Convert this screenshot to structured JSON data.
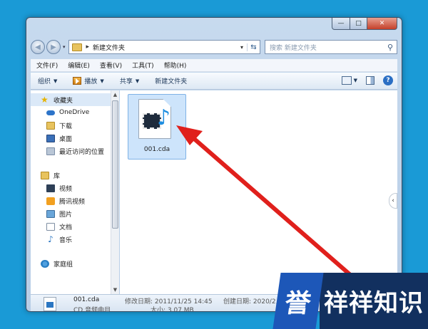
{
  "window": {
    "controls": {
      "minimize": "—",
      "maximize": "□",
      "close": "✕"
    }
  },
  "navbar": {
    "back": "◀",
    "forward": "▶",
    "history_dropdown": "▾",
    "breadcrumb_sep": "▸",
    "path": "新建文件夹",
    "addr_dropdown": "▾",
    "refresh": "⇆",
    "search_placeholder": "搜索 新建文件夹",
    "search_icon": "⚲"
  },
  "menu": [
    "文件(F)",
    "编辑(E)",
    "查看(V)",
    "工具(T)",
    "帮助(H)"
  ],
  "toolbar": {
    "organize": "组织",
    "play": "播放",
    "share": "共享",
    "new_folder": "新建文件夹",
    "dropdown": "▼",
    "help": "?"
  },
  "sidebar": {
    "favorites": {
      "label": "收藏夹",
      "items": [
        "OneDrive",
        "下载",
        "桌面",
        "最近访问的位置"
      ]
    },
    "libraries": {
      "label": "库",
      "items": [
        "视频",
        "腾讯视频",
        "图片",
        "文档",
        "音乐"
      ]
    },
    "homegroup": "家庭组",
    "scroll_up": "▲",
    "scroll_down": "▼"
  },
  "content": {
    "file": {
      "name": "001.cda",
      "icon": "cda-audio-icon"
    },
    "scroll_handle": "‹"
  },
  "details": {
    "name": "001.cda",
    "type": "CD 音频曲目",
    "modified_label": "修改日期: 2011/11/25 14:45",
    "size_label": "大小: 3.07 MB",
    "created_label": "创建日期: 2020/2,"
  },
  "watermark": {
    "seal": "誉",
    "text": "祥祥知识"
  },
  "colors": {
    "desktop": "#1a9ad6",
    "arrow": "#e0201c",
    "selection": "#cde4fb"
  }
}
